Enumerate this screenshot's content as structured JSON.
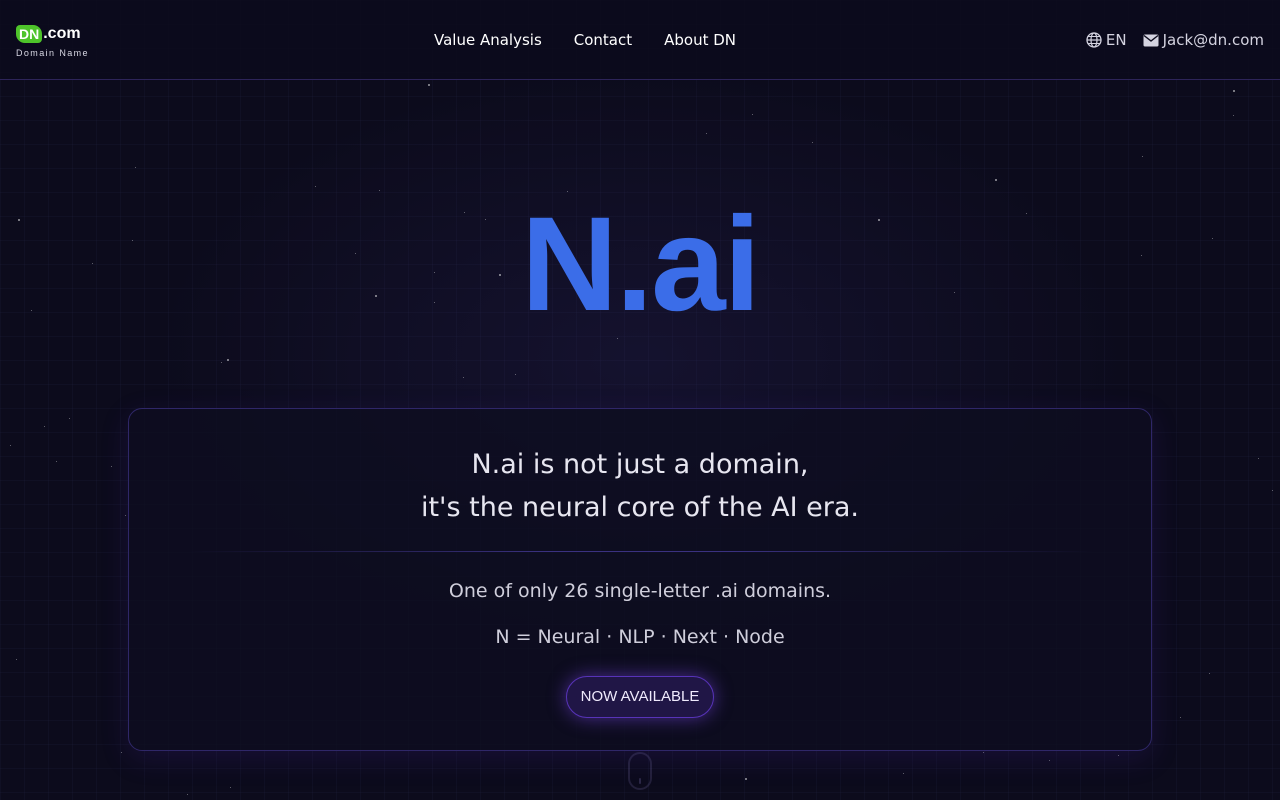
{
  "header": {
    "logo": {
      "mark": "DN",
      "suffix": ".com",
      "subtitle": "Domain Name"
    },
    "nav": [
      {
        "label": "Value Analysis"
      },
      {
        "label": "Contact"
      },
      {
        "label": "About DN"
      }
    ],
    "language": {
      "label": "EN",
      "icon": "globe-icon"
    },
    "email": {
      "label": "Jack@dn.com",
      "icon": "mail-icon"
    }
  },
  "hero": {
    "domain": "N.ai"
  },
  "card": {
    "tagline_line1": "N.ai is not just a domain,",
    "tagline_line2": "it's the neural core of the AI era.",
    "fact": "One of only 26 single-letter .ai domains.",
    "meaning": "N = Neural · NLP · Next · Node",
    "cta_label": "NOW AVAILABLE"
  },
  "colors": {
    "background": "#0c0b1c",
    "accent_blue": "#3b6de8",
    "logo_green": "#4ec42a",
    "border_purple": "#2f2768"
  },
  "scroll_indicator": {
    "icon": "mouse-scroll-icon"
  }
}
